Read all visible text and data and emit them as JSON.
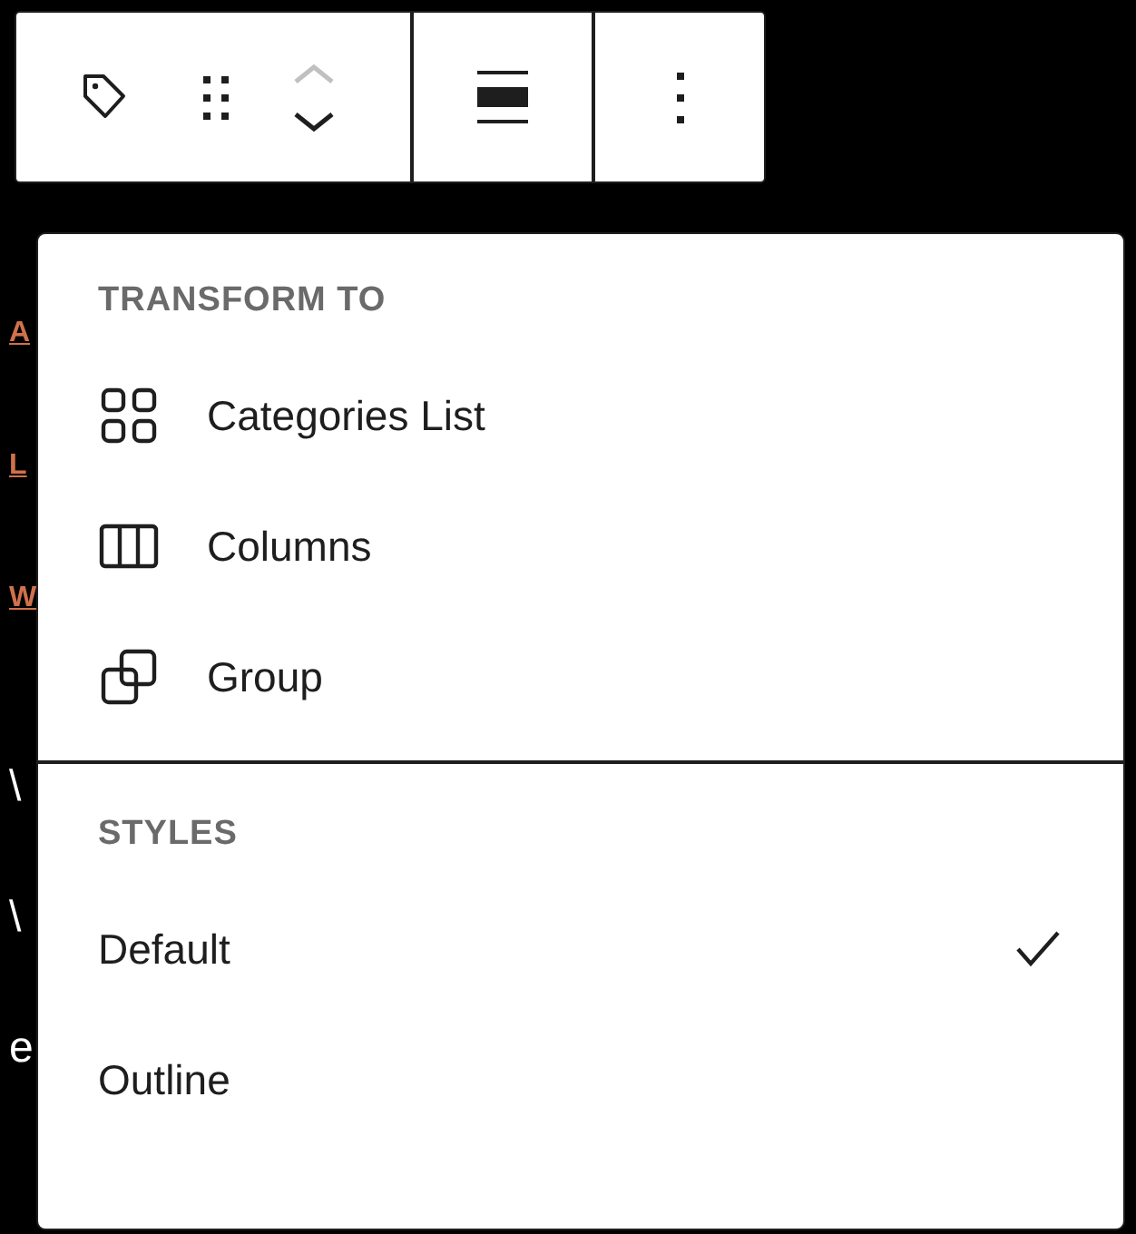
{
  "toolbar": {
    "move_up_disabled": true
  },
  "background_fragments": [
    {
      "text": "A",
      "kind": "link"
    },
    {
      "text": "L",
      "kind": "link"
    },
    {
      "text": "W",
      "kind": "link"
    },
    {
      "text": "\\",
      "kind": "plain"
    },
    {
      "text": "\\",
      "kind": "plain"
    },
    {
      "text": "e",
      "kind": "plain"
    }
  ],
  "menu": {
    "sections": [
      {
        "title": "TRANSFORM TO",
        "items": [
          {
            "label": "Categories List",
            "kind": "grid"
          },
          {
            "label": "Columns",
            "kind": "columns"
          },
          {
            "label": "Group",
            "kind": "group"
          }
        ]
      },
      {
        "title": "STYLES",
        "items": [
          {
            "label": "Default",
            "kind": "style",
            "selected": true
          },
          {
            "label": "Outline",
            "kind": "style",
            "selected": false
          }
        ]
      }
    ]
  }
}
